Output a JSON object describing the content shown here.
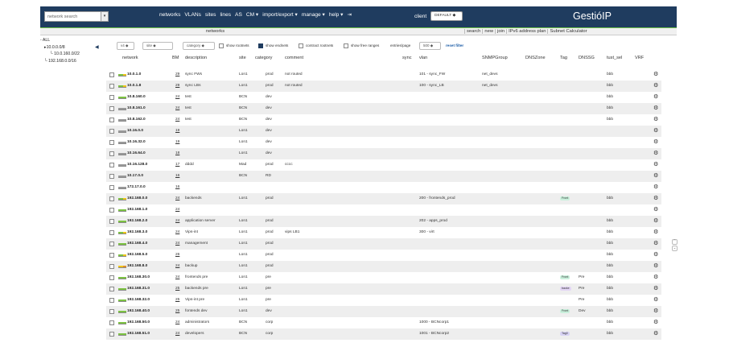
{
  "header": {
    "search_placeholder": "network search",
    "search_button": "▾",
    "nav": [
      {
        "label": "networks"
      },
      {
        "label": "VLANs"
      },
      {
        "label": "sites"
      },
      {
        "label": "lines"
      },
      {
        "label": "AS"
      },
      {
        "label": "CM ▾"
      },
      {
        "label": "import/export ▾"
      },
      {
        "label": "manage ▾"
      },
      {
        "label": "help ▾"
      },
      {
        "label": "⇥"
      }
    ],
    "client_label": "client",
    "client_value": "DEFAULT ◆",
    "brand": "GestióIP"
  },
  "subbar": {
    "title": "networks",
    "tabs": [
      "search",
      "new",
      "join",
      "IPv6 address plan",
      "Subnet Calculator"
    ]
  },
  "tree": [
    {
      "label": "ALL",
      "level": 0
    },
    {
      "label": "10.0.0.0/8",
      "level": 1,
      "marker": "▸"
    },
    {
      "label": "10.0.160.0/22",
      "level": 2
    },
    {
      "label": "192.168.0.0/16",
      "level": 1
    }
  ],
  "collapse_icon": "◀",
  "filters": {
    "ip_select": "v4 ◆",
    "site_select": "site ◆",
    "category_select": "category ◆",
    "show_rootnets": "show rootnets",
    "show_endnets": "show endnets",
    "contract_rootnets": "contract rootnets",
    "show_free_ranges": "show free ranges",
    "entries_label": "entries/page",
    "entries_value": "500 ◆",
    "reset_filter": "reset filter"
  },
  "columns": [
    "network",
    "BM",
    "description",
    "site",
    "category",
    "comment",
    "sync",
    "vlan",
    "SNMPGroup",
    "DNSZone",
    "Tag",
    "DNSSG",
    "tust_sel",
    "VRF"
  ],
  "rows": [
    {
      "network": "10.0.1.0",
      "bm": "29",
      "description": "sync FWs",
      "site": "Lon1",
      "category": "prod",
      "comment": "not routed",
      "vlan": "101 - sync_FW",
      "snmp": "net_devs",
      "tag": "",
      "dnssg": "",
      "tust": "bbb",
      "bar": "#7cc242",
      "bar2": "#f0c419"
    },
    {
      "network": "10.0.1.8",
      "bm": "29",
      "description": "sync LBs",
      "site": "Lon1",
      "category": "prod",
      "comment": "not routed",
      "vlan": "100 - sync_LB",
      "snmp": "net_devs",
      "tag": "",
      "dnssg": "",
      "tust": "bbb",
      "bar": "#7cc242",
      "bar2": "#f0c419"
    },
    {
      "network": "10.8.160.0",
      "bm": "24",
      "description": "test",
      "site": "BCN",
      "category": "dev",
      "comment": "",
      "vlan": "",
      "snmp": "",
      "tag": "",
      "dnssg": "",
      "tust": "bbb",
      "bar": "#7cc242",
      "bar2": ""
    },
    {
      "network": "10.8.161.0",
      "bm": "24",
      "description": "test",
      "site": "BCN",
      "category": "dev",
      "comment": "",
      "vlan": "",
      "snmp": "",
      "tag": "",
      "dnssg": "",
      "tust": "bbb",
      "bar": "#999999",
      "bar2": ""
    },
    {
      "network": "10.8.162.0",
      "bm": "24",
      "description": "test",
      "site": "BCN",
      "category": "dev",
      "comment": "",
      "vlan": "",
      "snmp": "",
      "tag": "",
      "dnssg": "",
      "tust": "bbb",
      "bar": "#999999",
      "bar2": ""
    },
    {
      "network": "10.16.0.0",
      "bm": "19",
      "description": "",
      "site": "Lon1",
      "category": "dev",
      "comment": "",
      "vlan": "",
      "snmp": "",
      "tag": "",
      "dnssg": "",
      "tust": "",
      "bar": "#999999",
      "bar2": ""
    },
    {
      "network": "10.16.32.0",
      "bm": "19",
      "description": "",
      "site": "Lon1",
      "category": "dev",
      "comment": "",
      "vlan": "",
      "snmp": "",
      "tag": "",
      "dnssg": "",
      "tust": "",
      "bar": "#999999",
      "bar2": ""
    },
    {
      "network": "10.16.64.0",
      "bm": "18",
      "description": "",
      "site": "Lon1",
      "category": "dev",
      "comment": "",
      "vlan": "",
      "snmp": "",
      "tag": "",
      "dnssg": "",
      "tust": "",
      "bar": "#999999",
      "bar2": ""
    },
    {
      "network": "10.16.128.0",
      "bm": "17",
      "description": "dddd",
      "site": "Mad",
      "category": "prod",
      "comment": "cccc",
      "vlan": "",
      "snmp": "",
      "tag": "",
      "dnssg": "",
      "tust": "",
      "bar": "#999999",
      "bar2": ""
    },
    {
      "network": "10.17.0.0",
      "bm": "16",
      "description": "",
      "site": "BCN",
      "category": "RD",
      "comment": "",
      "vlan": "",
      "snmp": "",
      "tag": "",
      "dnssg": "",
      "tust": "",
      "bar": "#999999",
      "bar2": ""
    },
    {
      "network": "172.17.0.0",
      "bm": "16",
      "description": "",
      "site": "",
      "category": "",
      "comment": "",
      "vlan": "",
      "snmp": "",
      "tag": "",
      "dnssg": "",
      "tust": "",
      "bar": "#999999",
      "bar2": ""
    },
    {
      "network": "192.168.0.0",
      "bm": "24",
      "description": "backends",
      "site": "Lon1",
      "category": "prod",
      "comment": "",
      "vlan": "200 - frontends_prod",
      "snmp": "",
      "tag": "Front",
      "tagcolor": "#c9f0dc",
      "dnssg": "",
      "tust": "bbb",
      "bar": "#7cc242",
      "bar2": "#f0c419"
    },
    {
      "network": "192.168.1.0",
      "bm": "24",
      "description": "",
      "site": "",
      "category": "",
      "comment": "",
      "vlan": "",
      "snmp": "",
      "tag": "",
      "dnssg": "",
      "tust": "",
      "bar": "#7cc242",
      "bar2": ""
    },
    {
      "network": "192.168.2.0",
      "bm": "24",
      "description": "application server",
      "site": "Lon1",
      "category": "prod",
      "comment": "",
      "vlan": "202 - apps_prod",
      "snmp": "",
      "tag": "",
      "dnssg": "",
      "tust": "bbb",
      "bar": "#7cc242",
      "bar2": ""
    },
    {
      "network": "192.168.3.0",
      "bm": "24",
      "description": "Vips-int",
      "site": "Lon1",
      "category": "prod",
      "comment": "vips LB1",
      "vlan": "300 - virt",
      "snmp": "",
      "tag": "",
      "dnssg": "",
      "tust": "bbb",
      "bar": "#7cc242",
      "bar2": "#f0c419"
    },
    {
      "network": "192.168.4.0",
      "bm": "24",
      "description": "management",
      "site": "Lon1",
      "category": "prod",
      "comment": "",
      "vlan": "",
      "snmp": "",
      "tag": "",
      "dnssg": "",
      "tust": "bbb",
      "bar": "#7cc242",
      "bar2": ""
    },
    {
      "network": "192.168.5.0",
      "bm": "26",
      "description": "",
      "site": "Lon1",
      "category": "prod",
      "comment": "",
      "vlan": "",
      "snmp": "",
      "tag": "",
      "dnssg": "",
      "tust": "bbb",
      "bar": "#7cc242",
      "bar2": "#f0c419"
    },
    {
      "network": "192.168.8.0",
      "bm": "24",
      "description": "backup",
      "site": "Lon1",
      "category": "prod",
      "comment": "",
      "vlan": "",
      "snmp": "",
      "tag": "",
      "dnssg": "",
      "tust": "bbb",
      "bar": "#f0c419",
      "bar2": "#e0902a"
    },
    {
      "network": "192.168.30.0",
      "bm": "24",
      "description": "frontends pre",
      "site": "Lon1",
      "category": "pre",
      "comment": "",
      "vlan": "",
      "snmp": "",
      "tag": "Front",
      "tagcolor": "#c9f0dc",
      "dnssg": "Pre",
      "tust": "bbb",
      "bar": "#7cc242",
      "bar2": ""
    },
    {
      "network": "192.168.31.0",
      "bm": "25",
      "description": "backends pre",
      "site": "Lon1",
      "category": "pre",
      "comment": "",
      "vlan": "",
      "snmp": "",
      "tag": "backe",
      "tagcolor": "#e3d5f5",
      "dnssg": "Pre",
      "tust": "bbb",
      "bar": "#7cc242",
      "bar2": ""
    },
    {
      "network": "192.168.32.0",
      "bm": "25",
      "description": "Vips-int pre",
      "site": "Lon1",
      "category": "pre",
      "comment": "",
      "vlan": "",
      "snmp": "",
      "tag": "",
      "dnssg": "Pre",
      "tust": "bbb",
      "bar": "#7cc242",
      "bar2": ""
    },
    {
      "network": "192.168.40.0",
      "bm": "25",
      "description": "fontends dev",
      "site": "Lon1",
      "category": "dev",
      "comment": "",
      "vlan": "",
      "snmp": "",
      "tag": "Front",
      "tagcolor": "#c9f0dc",
      "dnssg": "Dev",
      "tust": "bbb",
      "bar": "#7cc242",
      "bar2": ""
    },
    {
      "network": "192.168.50.0",
      "bm": "24",
      "description": "administrators",
      "site": "BCN",
      "category": "corp",
      "comment": "",
      "vlan": "1000 - BCNcorp1",
      "snmp": "",
      "tag": "",
      "dnssg": "",
      "tust": "bbb",
      "bar": "#7cc242",
      "bar2": ""
    },
    {
      "network": "192.168.51.0",
      "bm": "24",
      "description": "developers",
      "site": "BCN",
      "category": "corp",
      "comment": "",
      "vlan": "1001 - BCNcorp2",
      "snmp": "",
      "tag": "Tag0",
      "tagcolor": "#d8d3f5",
      "dnssg": "",
      "tust": "bbb",
      "bar": "#7cc242",
      "bar2": ""
    }
  ],
  "gear_icon": "⚙",
  "scroll_up": "⌃",
  "scroll_down": "⌄"
}
